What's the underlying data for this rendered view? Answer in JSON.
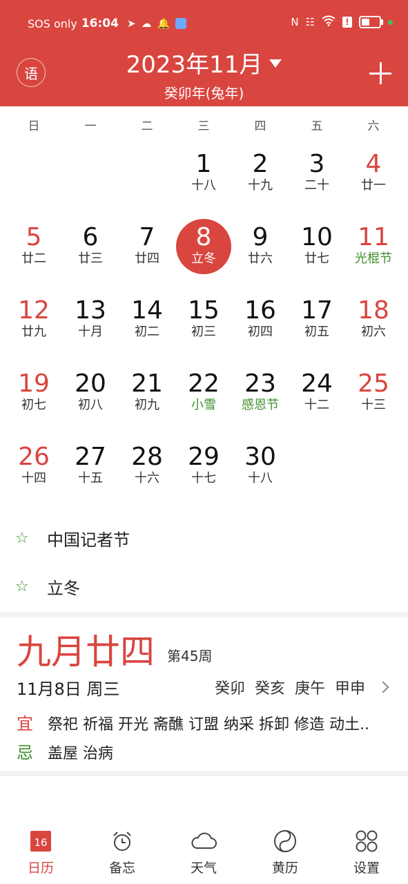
{
  "status_bar": {
    "carrier": "SOS only",
    "time": "16:04",
    "icons": [
      "telegram-icon",
      "cloud-icon",
      "bell-icon",
      "app-icon"
    ],
    "right_icons": [
      "nfc-icon",
      "vibrate-icon",
      "wifi-icon",
      "alert-icon",
      "battery-icon"
    ],
    "battery_level": 0.45
  },
  "header": {
    "lang_button": "语",
    "title": "2023年11月",
    "subtitle": "癸卯年(兔年)",
    "accent_color": "#d9453f"
  },
  "weekdays": [
    "日",
    "一",
    "二",
    "三",
    "四",
    "五",
    "六"
  ],
  "calendar": {
    "days": [
      {
        "col": 3,
        "row": 0,
        "day": "1",
        "lunar": "十八"
      },
      {
        "col": 4,
        "row": 0,
        "day": "2",
        "lunar": "十九"
      },
      {
        "col": 5,
        "row": 0,
        "day": "3",
        "lunar": "二十"
      },
      {
        "col": 6,
        "row": 0,
        "day": "4",
        "lunar": "廿一",
        "weekend": true
      },
      {
        "col": 0,
        "row": 1,
        "day": "5",
        "lunar": "廿二",
        "weekend": true
      },
      {
        "col": 1,
        "row": 1,
        "day": "6",
        "lunar": "廿三"
      },
      {
        "col": 2,
        "row": 1,
        "day": "7",
        "lunar": "廿四"
      },
      {
        "col": 3,
        "row": 1,
        "day": "8",
        "lunar": "立冬",
        "today": true
      },
      {
        "col": 4,
        "row": 1,
        "day": "9",
        "lunar": "廿六"
      },
      {
        "col": 5,
        "row": 1,
        "day": "10",
        "lunar": "廿七"
      },
      {
        "col": 6,
        "row": 1,
        "day": "11",
        "lunar": "光棍节",
        "weekend": true,
        "festival": true
      },
      {
        "col": 0,
        "row": 2,
        "day": "12",
        "lunar": "廿九",
        "weekend": true
      },
      {
        "col": 1,
        "row": 2,
        "day": "13",
        "lunar": "十月"
      },
      {
        "col": 2,
        "row": 2,
        "day": "14",
        "lunar": "初二"
      },
      {
        "col": 3,
        "row": 2,
        "day": "15",
        "lunar": "初三"
      },
      {
        "col": 4,
        "row": 2,
        "day": "16",
        "lunar": "初四"
      },
      {
        "col": 5,
        "row": 2,
        "day": "17",
        "lunar": "初五"
      },
      {
        "col": 6,
        "row": 2,
        "day": "18",
        "lunar": "初六",
        "weekend": true
      },
      {
        "col": 0,
        "row": 3,
        "day": "19",
        "lunar": "初七",
        "weekend": true
      },
      {
        "col": 1,
        "row": 3,
        "day": "20",
        "lunar": "初八"
      },
      {
        "col": 2,
        "row": 3,
        "day": "21",
        "lunar": "初九"
      },
      {
        "col": 3,
        "row": 3,
        "day": "22",
        "lunar": "小雪",
        "festival": true
      },
      {
        "col": 4,
        "row": 3,
        "day": "23",
        "lunar": "感恩节",
        "festival": true
      },
      {
        "col": 5,
        "row": 3,
        "day": "24",
        "lunar": "十二"
      },
      {
        "col": 6,
        "row": 3,
        "day": "25",
        "lunar": "十三",
        "weekend": true
      },
      {
        "col": 0,
        "row": 4,
        "day": "26",
        "lunar": "十四",
        "weekend": true
      },
      {
        "col": 1,
        "row": 4,
        "day": "27",
        "lunar": "十五"
      },
      {
        "col": 2,
        "row": 4,
        "day": "28",
        "lunar": "十六"
      },
      {
        "col": 3,
        "row": 4,
        "day": "29",
        "lunar": "十七"
      },
      {
        "col": 4,
        "row": 4,
        "day": "30",
        "lunar": "十八"
      }
    ]
  },
  "events": [
    {
      "label": "中国记者节"
    },
    {
      "label": "立冬"
    }
  ],
  "day_card": {
    "lunar_date": "九月廿四",
    "week": "第45周",
    "date_line": "11月8日 周三",
    "ganzhi": [
      "癸卯",
      "癸亥",
      "庚午",
      "甲申"
    ],
    "yi_label": "宜",
    "yi_text": "祭祀 祈福 开光 斋醮 订盟 纳采 拆卸 修造 动土..",
    "ji_label": "忌",
    "ji_text": "盖屋 治病"
  },
  "tabs": [
    {
      "label": "日历",
      "icon": "calendar-icon",
      "badge": "16",
      "active": true
    },
    {
      "label": "备忘",
      "icon": "alarm-clock-icon"
    },
    {
      "label": "天气",
      "icon": "cloud-icon"
    },
    {
      "label": "黄历",
      "icon": "yin-yang-icon"
    },
    {
      "label": "设置",
      "icon": "grid-settings-icon"
    }
  ]
}
